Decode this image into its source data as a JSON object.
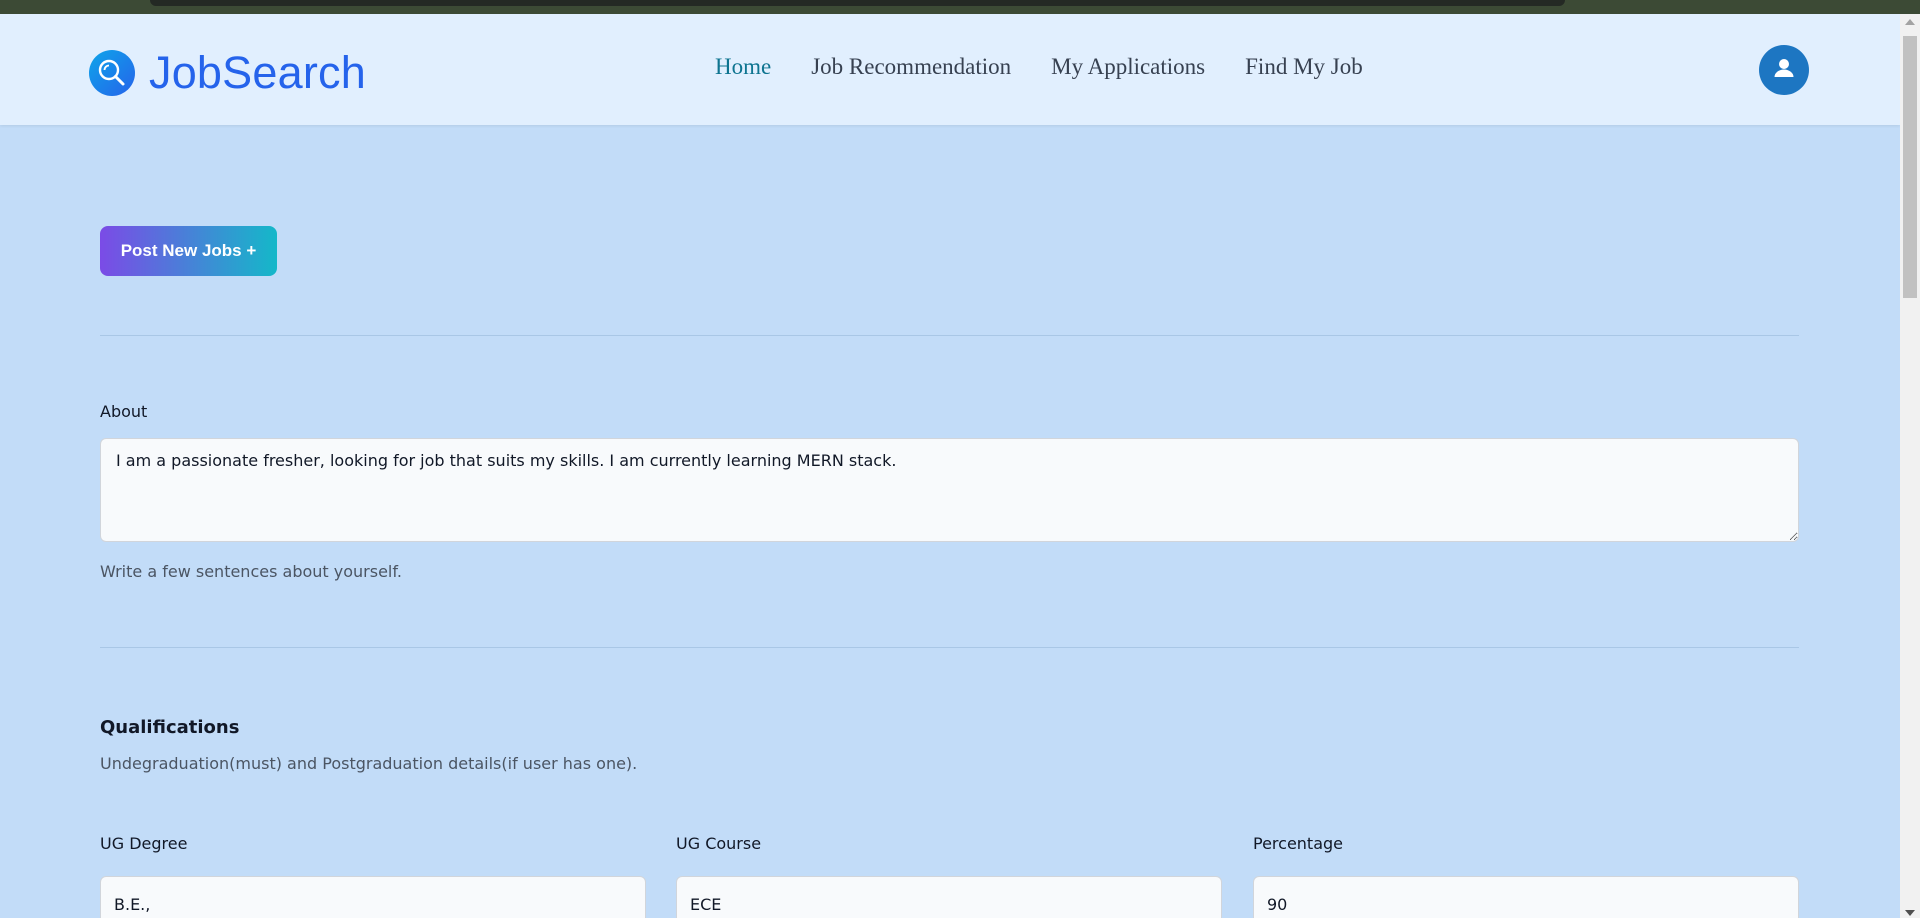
{
  "app": {
    "name": "JobSearch"
  },
  "nav": {
    "items": [
      {
        "label": "Home",
        "active": true
      },
      {
        "label": "Job Recommendation",
        "active": false
      },
      {
        "label": "My Applications",
        "active": false
      },
      {
        "label": "Find My Job",
        "active": false
      }
    ]
  },
  "actions": {
    "post_jobs_label": "Post New Jobs +"
  },
  "about": {
    "label": "About",
    "value": "I am a passionate fresher, looking for job that suits my skills. I am currently learning MERN stack.",
    "help": "Write a few sentences about yourself."
  },
  "qualifications": {
    "title": "Qualifications",
    "help": "Undegraduation(must) and Postgraduation details(if user has one).",
    "fields": [
      {
        "label": "UG Degree",
        "value": "B.E.,"
      },
      {
        "label": "UG Course",
        "value": "ECE"
      },
      {
        "label": "Percentage",
        "value": "90"
      }
    ]
  },
  "colors": {
    "brand": "#2563eb",
    "nav_active": "#0e7490",
    "page_bg": "#c2dcf8",
    "header_bg": "#e1effe",
    "button_gradient_start": "#7b4be6",
    "button_gradient_end": "#14b8c9"
  },
  "icons": {
    "logo": "magnifier-icon",
    "avatar": "user-icon"
  }
}
